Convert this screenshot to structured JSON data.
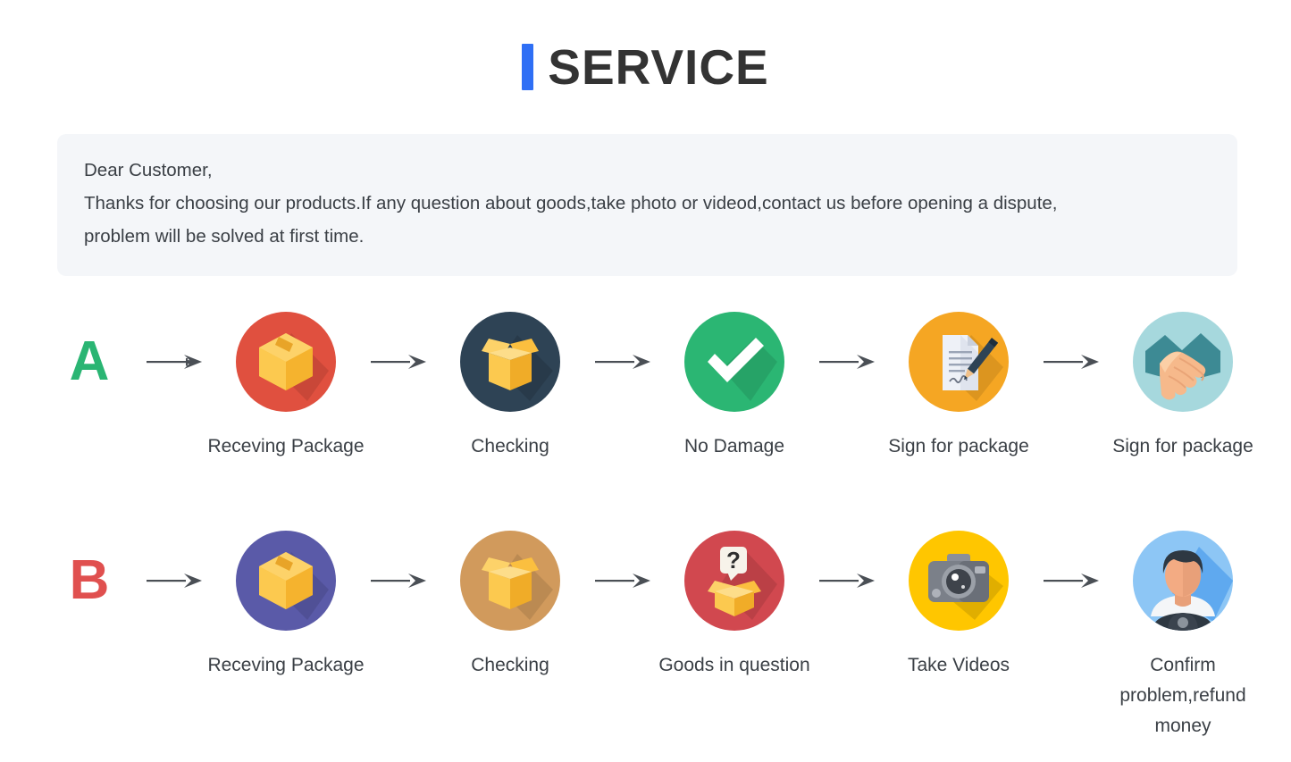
{
  "header": {
    "accent_color": "#2f6ff5",
    "title": "SERVICE"
  },
  "notice": {
    "line1": "Dear Customer,",
    "line2": "Thanks for choosing our products.If any question about goods,take photo or videod,contact us before opening a dispute,",
    "line3": "problem will be solved at first time."
  },
  "flows": [
    {
      "letter": "A",
      "letter_color": "#2ab573",
      "steps": [
        {
          "icon": "sealed-package-icon",
          "label": "Receving Package",
          "circle_color": "#e0503f"
        },
        {
          "icon": "open-box-icon",
          "label": "Checking",
          "circle_color": "#2e4355"
        },
        {
          "icon": "check-mark-icon",
          "label": "No Damage",
          "circle_color": "#2bb673"
        },
        {
          "icon": "sign-document-icon",
          "label": "Sign for package",
          "circle_color": "#f5a623"
        },
        {
          "icon": "handshake-icon",
          "label": "Sign for package",
          "circle_color": "#a6d8dd"
        }
      ]
    },
    {
      "letter": "B",
      "letter_color": "#e0504f",
      "steps": [
        {
          "icon": "sealed-package-icon",
          "label": "Receving Package",
          "circle_color": "#5a5aa8"
        },
        {
          "icon": "open-box-icon",
          "label": "Checking",
          "circle_color": "#d19a5c"
        },
        {
          "icon": "question-box-icon",
          "label": "Goods in question",
          "circle_color": "#d1484f"
        },
        {
          "icon": "camera-icon",
          "label": "Take Videos",
          "circle_color": "#ffc600"
        },
        {
          "icon": "support-agent-icon",
          "label": "Confirm problem,refund money",
          "circle_color": "#8dc6f5"
        }
      ]
    }
  ],
  "arrow": {
    "icon": "arrow-right-icon",
    "color": "#4a4f55"
  }
}
